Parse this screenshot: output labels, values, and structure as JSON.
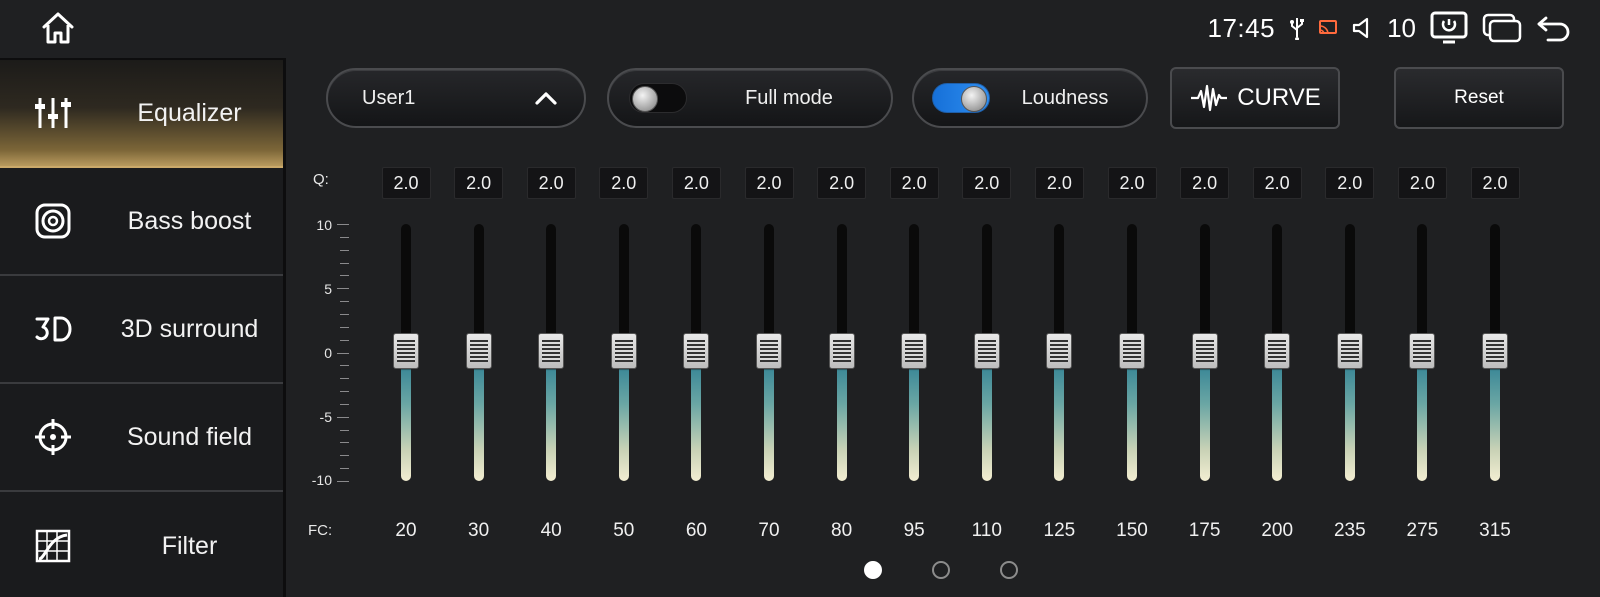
{
  "status": {
    "time": "17:45",
    "volume": "10",
    "icons": [
      "usb-icon",
      "cast-icon",
      "speaker-icon",
      "screen-icon",
      "windows-icon",
      "back-icon"
    ]
  },
  "sidebar": {
    "items": [
      {
        "label": "Equalizer",
        "icon": "equalizer-icon",
        "active": true
      },
      {
        "label": "Bass boost",
        "icon": "speaker-icon",
        "active": false
      },
      {
        "label": "3D surround",
        "icon": "3d-icon",
        "active": false
      },
      {
        "label": "Sound field",
        "icon": "target-icon",
        "active": false
      },
      {
        "label": "Filter",
        "icon": "filter-icon",
        "active": false
      }
    ]
  },
  "toolbar": {
    "preset": "User1",
    "full_mode_label": "Full mode",
    "full_mode_on": false,
    "loudness_label": "Loudness",
    "loudness_on": true,
    "curve_label": "CURVE",
    "reset_label": "Reset"
  },
  "eq": {
    "q_label": "Q:",
    "fc_label": "FC:",
    "scale": [
      "10",
      "5",
      "0",
      "-5",
      "-10"
    ],
    "q_values": [
      "2.0",
      "2.0",
      "2.0",
      "2.0",
      "2.0",
      "2.0",
      "2.0",
      "2.0",
      "2.0",
      "2.0",
      "2.0",
      "2.0",
      "2.0",
      "2.0",
      "2.0",
      "2.0"
    ],
    "fc_values": [
      "20",
      "30",
      "40",
      "50",
      "60",
      "70",
      "80",
      "95",
      "110",
      "125",
      "150",
      "175",
      "200",
      "235",
      "275",
      "315"
    ],
    "gains": [
      0,
      0,
      0,
      0,
      0,
      0,
      0,
      0,
      0,
      0,
      0,
      0,
      0,
      0,
      0,
      0
    ],
    "range": [
      -10,
      10
    ]
  },
  "pagination": {
    "pages": 3,
    "current": 1
  }
}
